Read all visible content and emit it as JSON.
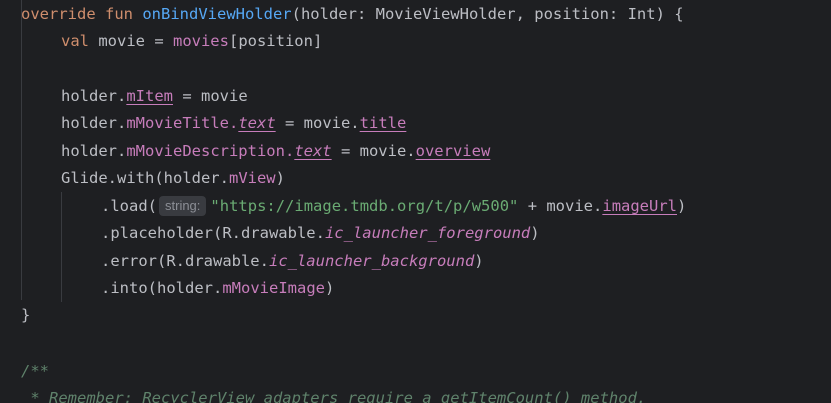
{
  "code": {
    "l1": {
      "kw": "override fun ",
      "fn": "onBindViewHolder",
      "rest": "(holder: MovieViewHolder, position: Int) {"
    },
    "l2": {
      "kw": "val ",
      "var": "movie = ",
      "prop": "movies",
      "rest": "[position]"
    },
    "l4": {
      "a": "holder.",
      "prop": "mItem",
      "b": " = movie"
    },
    "l5": {
      "a": "holder.",
      "prop1": "mMovieTitle",
      "dot": ".",
      "prop2": "text",
      "b": " = movie.",
      "prop3": "title"
    },
    "l6": {
      "a": "holder.",
      "prop1": "mMovieDescription",
      "dot": ".",
      "prop2": "text",
      "b": " = movie.",
      "prop3": "overview"
    },
    "l7": {
      "a": "Glide.with(holder.",
      "prop": "mView",
      "b": ")"
    },
    "l8": {
      "a": ".load(",
      "hint": "string:",
      "str": "\"https://image.tmdb.org/t/p/w500\"",
      "b": " + movie.",
      "prop": "imageUrl",
      "c": ")"
    },
    "l9": {
      "a": ".placeholder(R.drawable.",
      "prop": "ic_launcher_foreground",
      "b": ")"
    },
    "l10": {
      "a": ".error(R.drawable.",
      "prop": "ic_launcher_background",
      "b": ")"
    },
    "l11": {
      "a": ".into(holder.",
      "prop": "mMovieImage",
      "b": ")"
    },
    "l12": {
      "a": "}"
    },
    "l14": {
      "cm": "/**"
    },
    "l15": {
      "cm": " * Remember: RecyclerView adapters require a getItemCount() method."
    }
  },
  "colors": {
    "background": "#1e1f22",
    "keyword": "#cf8e6d",
    "function": "#56a8f5",
    "property": "#c77dbb",
    "string": "#6aab73",
    "comment": "#5f826b",
    "text": "#bcbec4"
  }
}
